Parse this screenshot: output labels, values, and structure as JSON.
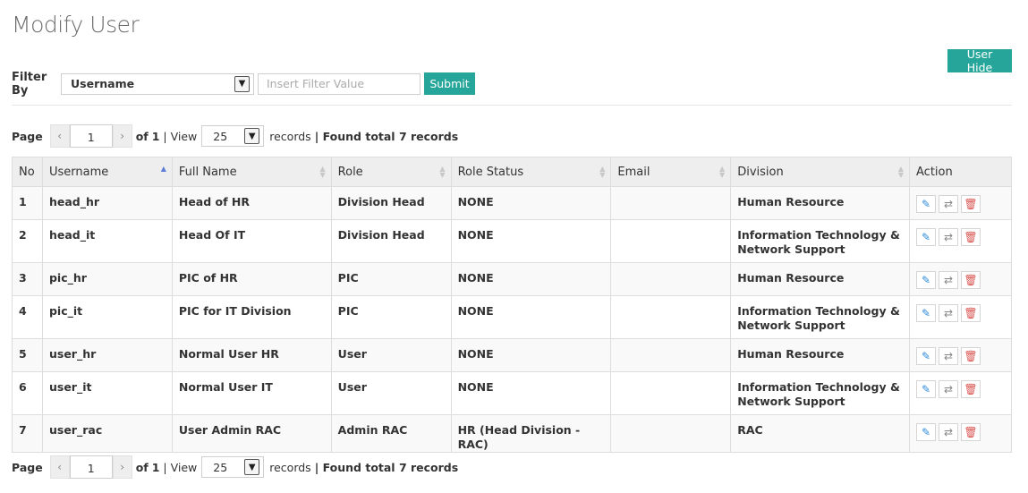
{
  "page": {
    "title": "Modify User"
  },
  "header": {
    "user_hide_label": "User Hide"
  },
  "filter": {
    "label": "Filter By",
    "selected": "Username",
    "placeholder": "Insert Filter Value",
    "submit_label": "Submit"
  },
  "pager": {
    "page_label": "Page",
    "prev": "‹",
    "next": "›",
    "current_page": "1",
    "of_text": "of",
    "total_pages": "1",
    "sep_view": "| View",
    "view_value": "25",
    "records_text": "records",
    "found_text": "| Found total 7 records"
  },
  "table": {
    "columns": [
      "No",
      "Username",
      "Full Name",
      "Role",
      "Role Status",
      "Email",
      "Division",
      "Action"
    ],
    "rows": [
      {
        "no": "1",
        "username": "head_hr",
        "full_name": "Head of HR",
        "role": "Division Head",
        "role_status": "NONE",
        "email": "",
        "division": "Human Resource"
      },
      {
        "no": "2",
        "username": "head_it",
        "full_name": "Head Of IT",
        "role": "Division Head",
        "role_status": "NONE",
        "email": "",
        "division": "Information Technology & Network Support"
      },
      {
        "no": "3",
        "username": "pic_hr",
        "full_name": "PIC of HR",
        "role": "PIC",
        "role_status": "NONE",
        "email": "",
        "division": "Human Resource"
      },
      {
        "no": "4",
        "username": "pic_it",
        "full_name": "PIC for IT Division",
        "role": "PIC",
        "role_status": "NONE",
        "email": "",
        "division": "Information Technology & Network Support"
      },
      {
        "no": "5",
        "username": "user_hr",
        "full_name": "Normal User HR",
        "role": "User",
        "role_status": "NONE",
        "email": "",
        "division": "Human Resource"
      },
      {
        "no": "6",
        "username": "user_it",
        "full_name": "Normal User IT",
        "role": "User",
        "role_status": "NONE",
        "email": "",
        "division": "Information Technology & Network Support"
      },
      {
        "no": "7",
        "username": "user_rac",
        "full_name": "User Admin RAC",
        "role": "Admin RAC",
        "role_status": "HR (Head Division - RAC)",
        "email": "",
        "division": "RAC"
      }
    ],
    "action_icons": [
      "edit-icon",
      "swap-icon",
      "trash-icon"
    ]
  },
  "colors": {
    "accent": "#26a69a",
    "edit": "#2e8bd9",
    "delete": "#d9534f"
  }
}
